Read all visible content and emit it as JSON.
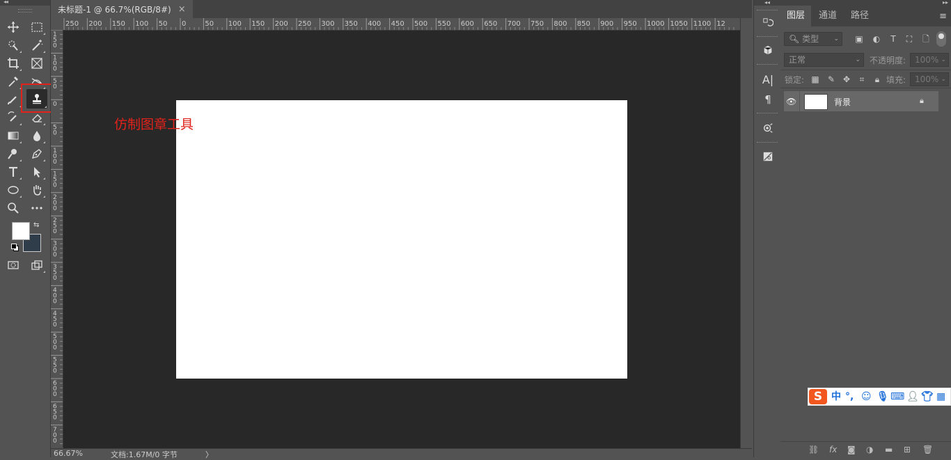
{
  "document": {
    "tab_title": "未标题-1 @ 66.7%(RGB/8#)",
    "tab_close": "×"
  },
  "ruler": {
    "top_labels": [
      "250",
      "200",
      "150",
      "100",
      "50",
      "0",
      "50",
      "100",
      "150",
      "200",
      "250",
      "300",
      "350",
      "400",
      "450",
      "500",
      "550",
      "600",
      "650",
      "700",
      "750",
      "800",
      "850",
      "900",
      "950",
      "1000",
      "1050",
      "1100",
      "12"
    ],
    "left_labels": [
      "150",
      "100",
      "50",
      "0",
      "50",
      "100",
      "150",
      "200",
      "250",
      "300",
      "350",
      "400",
      "450",
      "500",
      "550",
      "600",
      "650",
      "700"
    ]
  },
  "annotation": {
    "text": "仿制图章工具",
    "color": "#e0221b"
  },
  "status": {
    "zoom": "66.67%",
    "doc_info": "文档:1.67M/0 字节",
    "arrow": "〉"
  },
  "panel": {
    "tabs": [
      "图层",
      "通道",
      "路径"
    ],
    "filter_label": "类型",
    "blend_mode": "正常",
    "opacity_label": "不透明度:",
    "opacity_value": "100%",
    "lock_label": "锁定:",
    "fill_label": "填充:",
    "fill_value": "100%",
    "layer_name": "背景"
  },
  "toolbar": {
    "tools": [
      "move-tool",
      "marquee-tool",
      "quick-selection-tool",
      "magic-wand-tool",
      "crop-tool",
      "frame-tool",
      "eyedropper-tool",
      "ruler-tool",
      "brush-tool",
      "clone-stamp-tool",
      "history-brush-tool",
      "eraser-tool",
      "gradient-tool",
      "blur-tool",
      "dodge-tool",
      "pen-tool",
      "type-tool",
      "path-selection-tool",
      "ellipse-tool",
      "hand-tool",
      "zoom-tool",
      "more-tools"
    ],
    "foreground_color": "#ffffff",
    "background_color": "#2f3c4a",
    "active_tool": "clone-stamp-tool"
  },
  "ime": {
    "lang": "中",
    "punct": "°,"
  },
  "colors": {
    "workspace": "#282828",
    "canvas": "#ffffff",
    "chrome": "#535353"
  }
}
